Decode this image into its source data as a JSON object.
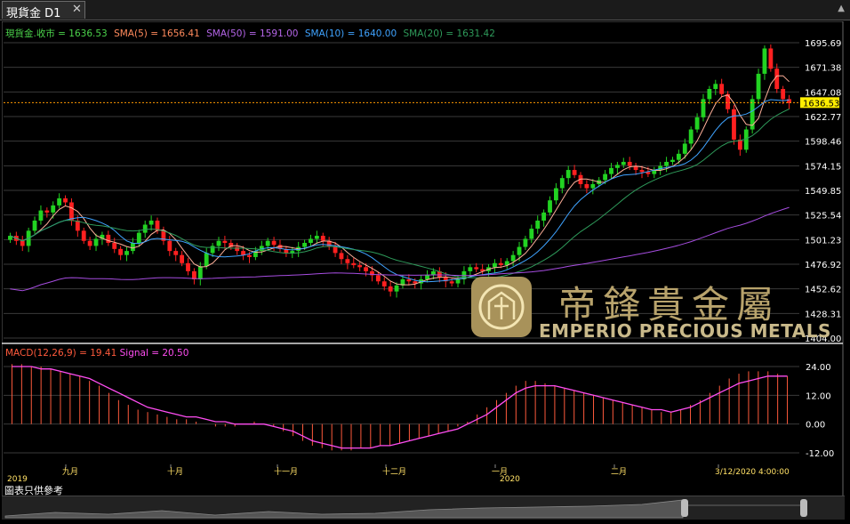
{
  "tab": {
    "title": "現貨金 D1",
    "close": "✕"
  },
  "legend": [
    {
      "text": "現貨金.收市 = 1636.53",
      "color": "#4bd34b"
    },
    {
      "text": "SMA(5) = 1656.41",
      "color": "#ff8a5c"
    },
    {
      "text": "SMA(50) = 1591.00",
      "color": "#b565e8"
    },
    {
      "text": "SMA(10) = 1640.00",
      "color": "#3fa3ff"
    },
    {
      "text": "SMA(20) = 1631.42",
      "color": "#2e9a5a"
    }
  ],
  "macd_legend": [
    {
      "text": "MACD(12,26,9) = 19.41",
      "color": "#ff5a3c"
    },
    {
      "text": "Signal = 20.50",
      "color": "#ff4df2"
    }
  ],
  "price_axis": [
    "1695.69",
    "1671.38",
    "1647.08",
    "1622.77",
    "1598.46",
    "1574.15",
    "1549.85",
    "1525.54",
    "1501.23",
    "1476.92",
    "1452.62",
    "1428.31",
    "1404.00"
  ],
  "current_price": "1636.53",
  "macd_axis": [
    "24.00",
    "12.00",
    "0.00",
    "-12.00"
  ],
  "time_labels": [
    {
      "text": "2019",
      "row": 1
    },
    {
      "text": "九月",
      "row": 0
    },
    {
      "text": "十月",
      "row": 0
    },
    {
      "text": "十一月",
      "row": 0
    },
    {
      "text": "十二月",
      "row": 0
    },
    {
      "text": "一月",
      "row": 0
    },
    {
      "text": "2020",
      "row": 1
    },
    {
      "text": "二月",
      "row": 0
    },
    {
      "text": "3/12/2020 4:00:00",
      "row": 0
    }
  ],
  "disclaimer": "圖表只供參考",
  "watermark": {
    "zh": "帝鋒貴金屬",
    "en": "EMPERIO PRECIOUS METALS"
  },
  "colors": {
    "up": "#22d322",
    "down": "#ff2020",
    "grid": "#3a3a3a",
    "price_line": "#ff9900",
    "macd_hist": "#ff5a3c",
    "signal": "#ff4df2"
  },
  "chart_data": {
    "type": "candlestick",
    "title": "現貨金 D1",
    "x_range": [
      "2019-08",
      "2020-03-12"
    ],
    "ylim": [
      1404.0,
      1695.69
    ],
    "closes": [
      1505,
      1500,
      1495,
      1510,
      1520,
      1530,
      1528,
      1535,
      1542,
      1538,
      1520,
      1510,
      1500,
      1495,
      1502,
      1506,
      1498,
      1492,
      1486,
      1490,
      1498,
      1508,
      1516,
      1520,
      1510,
      1500,
      1490,
      1486,
      1478,
      1470,
      1462,
      1475,
      1488,
      1495,
      1500,
      1498,
      1494,
      1490,
      1486,
      1484,
      1490,
      1495,
      1500,
      1496,
      1492,
      1488,
      1490,
      1494,
      1498,
      1502,
      1505,
      1500,
      1494,
      1488,
      1482,
      1478,
      1476,
      1474,
      1470,
      1466,
      1460,
      1455,
      1450,
      1456,
      1462,
      1460,
      1458,
      1462,
      1466,
      1470,
      1464,
      1460,
      1458,
      1462,
      1470,
      1474,
      1472,
      1470,
      1474,
      1478,
      1476,
      1480,
      1486,
      1494,
      1502,
      1512,
      1520,
      1528,
      1540,
      1552,
      1562,
      1570,
      1565,
      1556,
      1552,
      1556,
      1560,
      1566,
      1572,
      1575,
      1578,
      1574,
      1570,
      1568,
      1566,
      1570,
      1574,
      1578,
      1580,
      1586,
      1596,
      1610,
      1622,
      1640,
      1650,
      1655,
      1645,
      1630,
      1600,
      1590,
      1610,
      1640,
      1665,
      1690,
      1670,
      1650,
      1640,
      1636
    ],
    "macd": [
      25,
      25,
      24,
      24,
      23,
      22,
      21,
      20,
      18,
      16,
      13,
      10,
      8,
      6,
      5,
      4,
      3,
      2,
      2,
      1,
      0,
      -1,
      -1,
      -1,
      0,
      1,
      0,
      -1,
      -3,
      -5,
      -7,
      -9,
      -10,
      -11,
      -11,
      -11,
      -10,
      -10,
      -9,
      -9,
      -8,
      -7,
      -6,
      -5,
      -4,
      -3,
      -1,
      1,
      4,
      7,
      10,
      13,
      16,
      18,
      18,
      17,
      16,
      15,
      14,
      13,
      12,
      11,
      10,
      9,
      8,
      7,
      6,
      5,
      5,
      6,
      8,
      10,
      13,
      16,
      19,
      21,
      22,
      22,
      22,
      21,
      20
    ],
    "signal": [
      24,
      24,
      24,
      23,
      23,
      22,
      21,
      20,
      19,
      17,
      15,
      13,
      11,
      9,
      7,
      6,
      5,
      4,
      3,
      3,
      2,
      1,
      1,
      0,
      0,
      0,
      0,
      -1,
      -2,
      -3,
      -5,
      -7,
      -8,
      -9,
      -10,
      -10,
      -10,
      -10,
      -9,
      -9,
      -8,
      -7,
      -6,
      -5,
      -4,
      -3,
      -2,
      0,
      2,
      4,
      7,
      10,
      13,
      15,
      16,
      16,
      16,
      15,
      14,
      13,
      12,
      11,
      10,
      9,
      8,
      7,
      6,
      6,
      5,
      6,
      7,
      9,
      11,
      13,
      15,
      17,
      18,
      19,
      20,
      20,
      20
    ],
    "macd_ylim": [
      -12,
      24
    ]
  }
}
